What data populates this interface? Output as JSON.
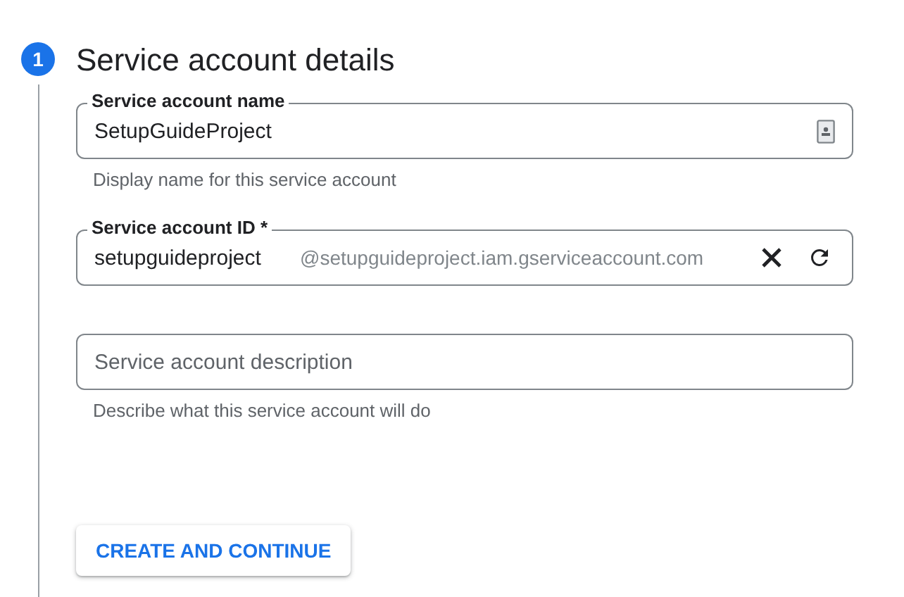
{
  "step": {
    "number": "1",
    "title": "Service account details"
  },
  "fields": [
    {
      "kind": "name",
      "label": "Service account name",
      "value": "SetupGuideProject",
      "hint": "Display name for this service account"
    },
    {
      "kind": "id",
      "label": "Service account ID *",
      "value": "setupguideproject",
      "suffix": "@setupguideproject.iam.gserviceaccount.com"
    },
    {
      "kind": "description",
      "placeholder": "Service account description",
      "hint": "Describe what this service account will do"
    }
  ],
  "button": "CREATE AND CONTINUE"
}
